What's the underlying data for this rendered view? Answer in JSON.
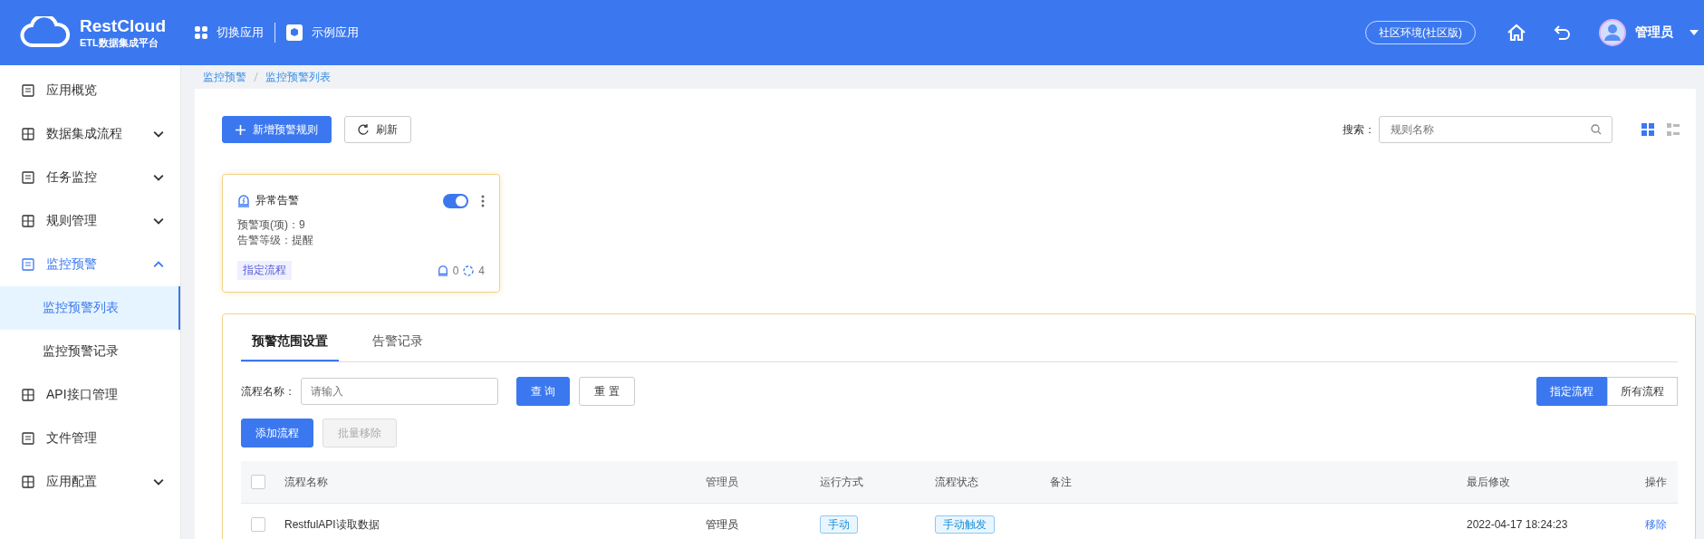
{
  "header": {
    "logo_title": "RestCloud",
    "logo_subtitle": "ETL数据集成平台",
    "nav": [
      "切换应用",
      "示例应用"
    ],
    "env": "社区环境(社区版)",
    "user": "管理员"
  },
  "sidebar": {
    "items": [
      {
        "label": "应用概览",
        "selected": false
      },
      {
        "label": "数据集成流程",
        "expanded": false,
        "selected": false
      },
      {
        "label": "任务监控",
        "expanded": false,
        "selected": false
      },
      {
        "label": "规则管理",
        "expanded": false,
        "selected": false
      },
      {
        "label": "监控预警",
        "expanded": true,
        "selected": true,
        "children": [
          {
            "label": "监控预警列表",
            "selected": true
          },
          {
            "label": "监控预警记录",
            "selected": false
          }
        ]
      },
      {
        "label": "API接口管理",
        "selected": false
      },
      {
        "label": "文件管理",
        "selected": false
      },
      {
        "label": "应用配置",
        "expanded": false,
        "selected": false
      }
    ]
  },
  "breadcrumb": [
    "监控预警",
    "监控预警列表"
  ],
  "toolbar": {
    "add": "新增预警规则",
    "refresh": "刷新",
    "search_label": "搜索：",
    "search_placeholder": "规则名称",
    "views": [
      {
        "kind": "grid",
        "selected": true
      },
      {
        "kind": "list",
        "selected": false
      }
    ]
  },
  "cards": [
    {
      "title": "异常告警",
      "enabled": true,
      "selected": true,
      "lines": [
        "预警项(项)：9",
        "告警等级：提醒"
      ],
      "tag": "指定流程",
      "alert_count": "0",
      "process_count": "4"
    }
  ],
  "panel": {
    "tabs": [
      {
        "label": "预警范围设置",
        "selected": true
      },
      {
        "label": "告警记录",
        "selected": false
      }
    ],
    "filter_label": "流程名称：",
    "filter_placeholder": "请输入",
    "search_button": "查 询",
    "reset_button": "重 置",
    "scope": [
      {
        "label": "指定流程",
        "selected": true
      },
      {
        "label": "所有流程",
        "selected": false
      }
    ],
    "add_button": "添加流程",
    "batch_button": {
      "label": "批量移除",
      "disabled": true
    },
    "table": {
      "header_checked": false,
      "columns": [
        "流程名称",
        "管理员",
        "运行方式",
        "流程状态",
        "备注",
        "最后修改",
        "操作"
      ],
      "rows": [
        {
          "checked": false,
          "name": "RestfulAPI读取数据",
          "admin": "管理员",
          "mode": "手动",
          "status": "手动触发",
          "modified": "2022-04-17 18:24:23",
          "action": "移除"
        }
      ]
    }
  }
}
